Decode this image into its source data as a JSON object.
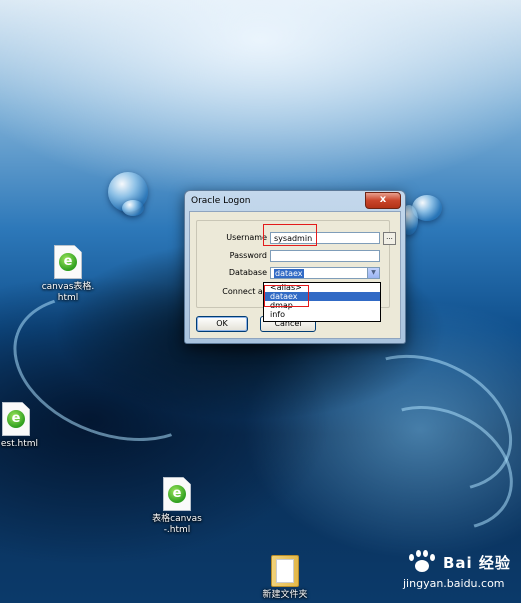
{
  "desktop": {
    "icons": [
      {
        "label": "canvas表格.html",
        "line1": "canvas表格.",
        "line2": "html",
        "type": "html-file"
      },
      {
        "label": "est.html",
        "line1": "est.html",
        "line2": "",
        "type": "html-file"
      },
      {
        "label": "表格canvas-.html",
        "line1": "表格canvas",
        "line2": "-.html",
        "type": "html-file"
      },
      {
        "label": "新建文件夹",
        "line1": "新建文件夹",
        "line2": "",
        "type": "folder"
      }
    ]
  },
  "dialog": {
    "title": "Oracle Logon",
    "close_symbol": "x",
    "username_label": "Username",
    "username_value": "sysadmin",
    "ellipsis": "...",
    "password_label": "Password",
    "password_value": "",
    "database_label": "Database",
    "database_value": "dataex",
    "connect_as_label": "Connect as",
    "connect_as_visible": "Connect as",
    "dropdown_options": [
      "<alias>",
      "dataex",
      "dmap",
      "info"
    ],
    "dropdown_selected": "dataex",
    "ok_label": "OK",
    "cancel_label": "Cancel"
  },
  "watermark": {
    "brand": "Bai 经验",
    "url": "jingyan.baidu.com"
  },
  "colors": {
    "highlight_box": "#e31b1b",
    "selection": "#316ac5"
  }
}
